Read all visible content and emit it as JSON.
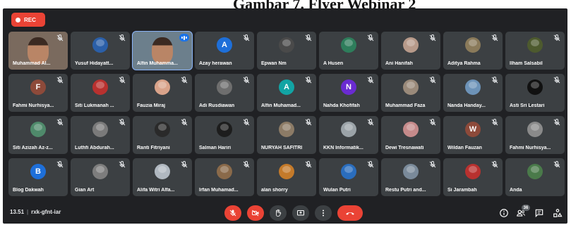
{
  "caption": "Gambar 7. Flyer Webinar 2",
  "meet": {
    "rec_label": "REC",
    "meeting_time": "13.51",
    "meeting_code": "rxk-gfnt-iar",
    "participant_count": "36"
  },
  "participants": [
    {
      "name": "Muhammad Al...",
      "kind": "video",
      "color": "#5a4a3e"
    },
    {
      "name": "Yusuf Hidayatt...",
      "kind": "photo",
      "color": "#2b5fa8"
    },
    {
      "name": "Alfin Muhamma...",
      "kind": "video",
      "color": "#3a5c7a"
    },
    {
      "name": "Azay herawan",
      "kind": "initial",
      "initial": "A",
      "color": "#1e6fd9"
    },
    {
      "name": "Epwan Nm",
      "kind": "photo",
      "color": "#4a4a4a"
    },
    {
      "name": "A Husen",
      "kind": "photo",
      "color": "#2e7d5b"
    },
    {
      "name": "Ani Hanifah",
      "kind": "photo",
      "color": "#b79a8a"
    },
    {
      "name": "Aditya Rahma",
      "kind": "photo",
      "color": "#8a7a5a"
    },
    {
      "name": "Ilham Salsabil",
      "kind": "photo",
      "color": "#4d5a2e"
    },
    {
      "name": "Fahmi Nurhisya...",
      "kind": "initial",
      "initial": "F",
      "color": "#8d4a3a"
    },
    {
      "name": "Siti Lukmanah ...",
      "kind": "photo",
      "color": "#b8312f"
    },
    {
      "name": "Fauzia Miraj",
      "kind": "photo",
      "color": "#d9a38a"
    },
    {
      "name": "Adi Rusdiawan",
      "kind": "photo",
      "color": "#6e6e6e"
    },
    {
      "name": "Alfin Muhamad...",
      "kind": "initial",
      "initial": "A",
      "color": "#12a4a4"
    },
    {
      "name": "Nahda Khofifah",
      "kind": "initial",
      "initial": "N",
      "color": "#6a2bd1"
    },
    {
      "name": "Muhammad Faza",
      "kind": "photo",
      "color": "#9a8a7a"
    },
    {
      "name": "Nanda Handay...",
      "kind": "photo",
      "color": "#6d93b8"
    },
    {
      "name": "Asti Sri Lestari",
      "kind": "photo",
      "color": "#111111"
    },
    {
      "name": "Siti Azizah Az-z...",
      "kind": "photo",
      "color": "#4f8a6b"
    },
    {
      "name": "Luthfi Abdurah...",
      "kind": "photo",
      "color": "#7a7a7a"
    },
    {
      "name": "Ranti Fitriyani",
      "kind": "photo",
      "color": "#2a2a2a"
    },
    {
      "name": "Salman Hariri",
      "kind": "photo",
      "color": "#1d1d1d"
    },
    {
      "name": "NURYAH SAFITRI",
      "kind": "photo",
      "color": "#8c7b66"
    },
    {
      "name": "KKN Informatik...",
      "kind": "photo",
      "color": "#9ba3a8"
    },
    {
      "name": "Dewi Tresnawati",
      "kind": "photo",
      "color": "#c58a8a"
    },
    {
      "name": "Wildan Fauzan",
      "kind": "initial",
      "initial": "W",
      "color": "#8d4a3a"
    },
    {
      "name": "Fahmi Nurhisya...",
      "kind": "photo",
      "color": "#8a8a8a"
    },
    {
      "name": "Blog Dakwah",
      "kind": "initial",
      "initial": "B",
      "color": "#1e6fd9"
    },
    {
      "name": "Gian Art",
      "kind": "photo",
      "color": "#7d7d7d"
    },
    {
      "name": "Alifa Witri Alfa...",
      "kind": "photo",
      "color": "#b0b8c0"
    },
    {
      "name": "Irfan Muhamad...",
      "kind": "photo",
      "color": "#8a6a4a"
    },
    {
      "name": "alan shorry",
      "kind": "photo",
      "color": "#c47a2a"
    },
    {
      "name": "Wulan Putri",
      "kind": "photo",
      "color": "#2a6dbd"
    },
    {
      "name": "Restu Putri and...",
      "kind": "photo",
      "color": "#7a8a9a"
    },
    {
      "name": "Si Jarambah",
      "kind": "photo",
      "color": "#b8312f"
    },
    {
      "name": "Anda",
      "kind": "photo",
      "color": "#4a7a4a"
    }
  ],
  "colors": {
    "background": "#202124",
    "tile": "#3c4043",
    "danger": "#ea4335",
    "active_speaker": "#8ab4f8"
  }
}
